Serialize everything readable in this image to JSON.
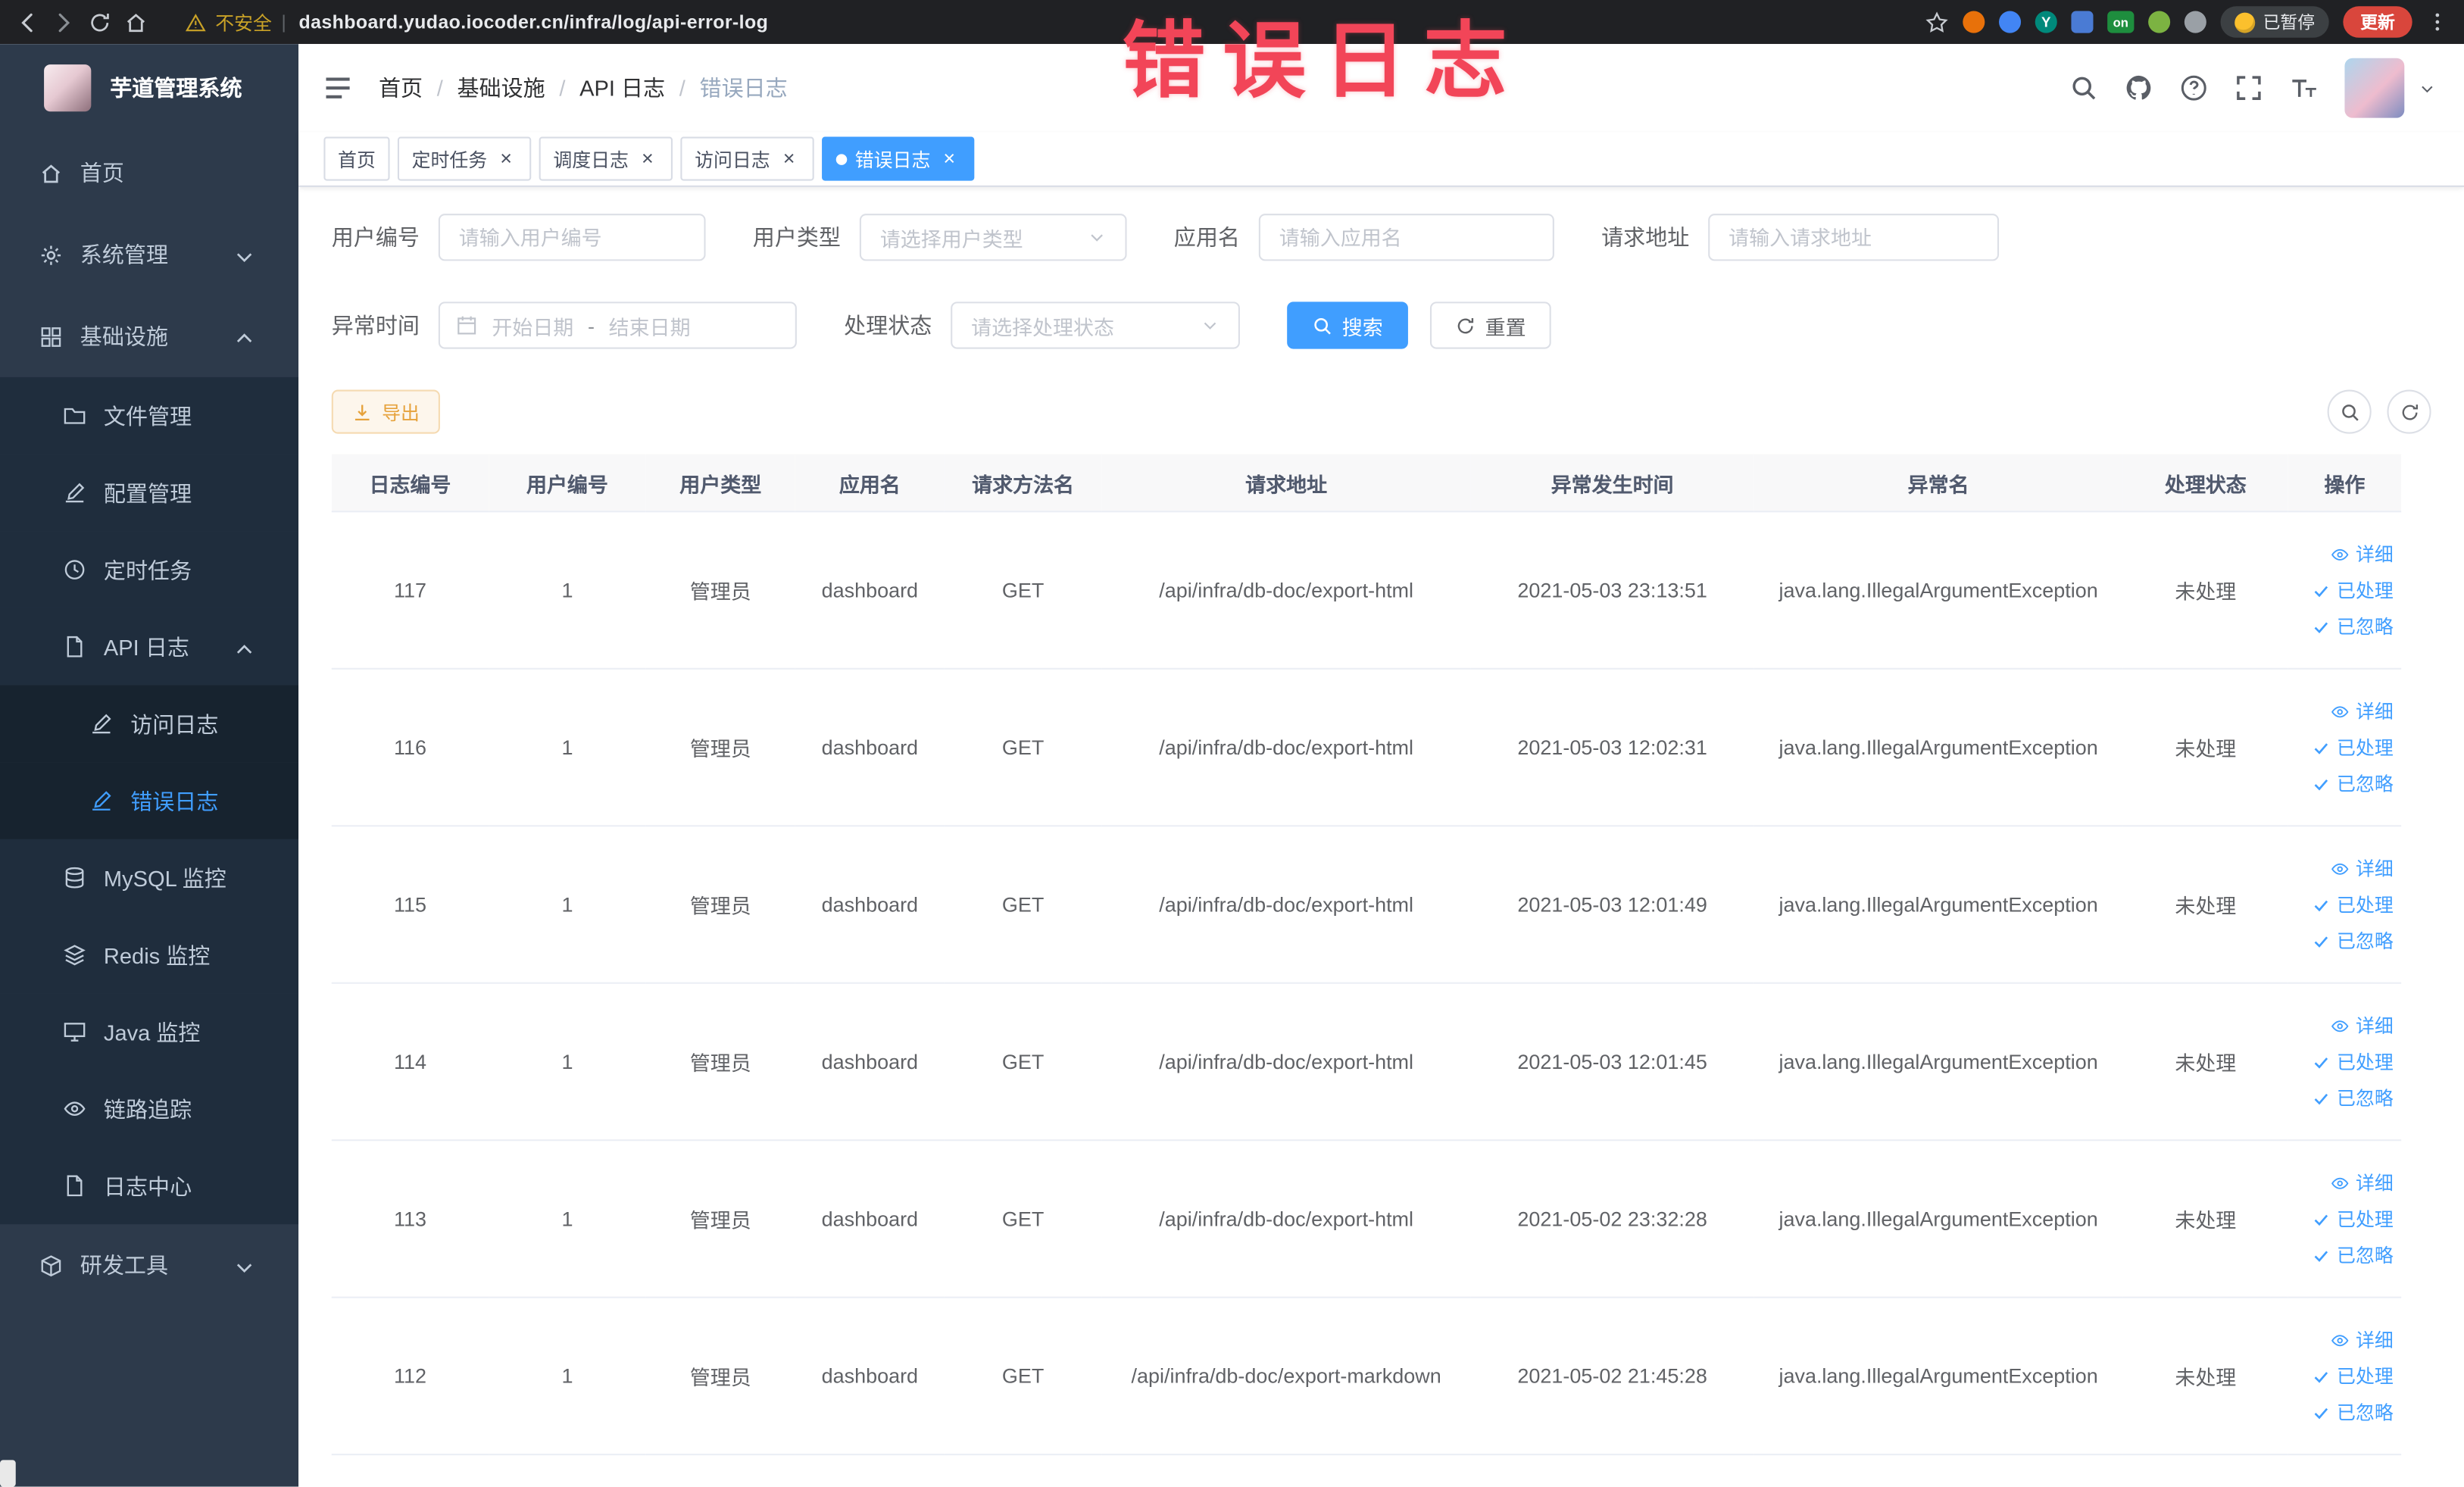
{
  "theme": {
    "accent": "#409eff",
    "sidebar_bg": "#2d3a4b",
    "submenu_bg": "#1f2d3d",
    "nested_submenu_bg": "#17232f",
    "warning": "#e6a23c",
    "watermark_color": "#f24558"
  },
  "browser": {
    "security_label": "不安全",
    "url": "dashboard.yudao.iocoder.cn/infra/log/api-error-log",
    "paused_badge": "已暂停",
    "update_button": "更新",
    "extensions": {
      "on_badge": "on",
      "y_logo": "Y"
    }
  },
  "watermark": {
    "text": "错误日志"
  },
  "sidebar": {
    "logo_title": "芋道管理系统",
    "menu": [
      {
        "name": "home",
        "label": "首页",
        "icon": "home",
        "depth": 1
      },
      {
        "name": "system-management",
        "label": "系统管理",
        "icon": "gear",
        "depth": 1,
        "arrow": "down"
      },
      {
        "name": "infrastructure",
        "label": "基础设施",
        "icon": "grid",
        "depth": 1,
        "arrow": "up"
      },
      {
        "name": "file-management",
        "label": "文件管理",
        "icon": "folder",
        "depth": 2
      },
      {
        "name": "config-management",
        "label": "配置管理",
        "icon": "edit",
        "depth": 2
      },
      {
        "name": "scheduled-tasks",
        "label": "定时任务",
        "icon": "clock",
        "depth": 2
      },
      {
        "name": "api-logs",
        "label": "API 日志",
        "icon": "doc",
        "depth": 2,
        "arrow": "up"
      },
      {
        "name": "access-log",
        "label": "访问日志",
        "icon": "edit",
        "depth": 3
      },
      {
        "name": "error-log",
        "label": "错误日志",
        "icon": "edit",
        "depth": 3,
        "active": true
      },
      {
        "name": "mysql-monitor",
        "label": "MySQL 监控",
        "icon": "db",
        "depth": 2
      },
      {
        "name": "redis-monitor",
        "label": "Redis 监控",
        "icon": "stack",
        "depth": 2
      },
      {
        "name": "java-monitor",
        "label": "Java 监控",
        "icon": "monitor",
        "depth": 2
      },
      {
        "name": "trace",
        "label": "链路追踪",
        "icon": "eye",
        "depth": 2
      },
      {
        "name": "log-center",
        "label": "日志中心",
        "icon": "doc",
        "depth": 2
      },
      {
        "name": "dev-tools",
        "label": "研发工具",
        "icon": "tool",
        "depth": 1,
        "arrow": "down"
      }
    ]
  },
  "navbar": {
    "breadcrumb": [
      "首页",
      "基础设施",
      "API 日志",
      "错误日志"
    ]
  },
  "tabs": [
    {
      "name": "home",
      "label": "首页",
      "closable": false,
      "active": false
    },
    {
      "name": "scheduled-tasks",
      "label": "定时任务",
      "closable": true,
      "active": false
    },
    {
      "name": "schedule-log",
      "label": "调度日志",
      "closable": true,
      "active": false
    },
    {
      "name": "access-log",
      "label": "访问日志",
      "closable": true,
      "active": false
    },
    {
      "name": "error-log",
      "label": "错误日志",
      "closable": true,
      "active": true
    }
  ],
  "filters": {
    "user_id": {
      "label": "用户编号",
      "placeholder": "请输入用户编号"
    },
    "user_type": {
      "label": "用户类型",
      "placeholder": "请选择用户类型"
    },
    "app_name": {
      "label": "应用名",
      "placeholder": "请输入应用名"
    },
    "request_url": {
      "label": "请求地址",
      "placeholder": "请输入请求地址"
    },
    "exception_time": {
      "label": "异常时间",
      "start_placeholder": "开始日期",
      "separator": "-",
      "end_placeholder": "结束日期"
    },
    "process_status": {
      "label": "处理状态",
      "placeholder": "请选择处理状态"
    },
    "search_button": "搜索",
    "reset_button": "重置"
  },
  "toolbar": {
    "export_label": "导出"
  },
  "table": {
    "columns": [
      "日志编号",
      "用户编号",
      "用户类型",
      "应用名",
      "请求方法名",
      "请求地址",
      "异常发生时间",
      "异常名",
      "处理状态",
      "操作"
    ],
    "actions": [
      {
        "name": "detail",
        "label": "详细",
        "icon": "eye"
      },
      {
        "name": "processed",
        "label": "已处理",
        "icon": "check"
      },
      {
        "name": "ignored",
        "label": "已忽略",
        "icon": "check"
      }
    ],
    "rows": [
      {
        "id": "117",
        "user_id": "1",
        "user_type": "管理员",
        "app": "dashboard",
        "method": "GET",
        "url": "/api/infra/db-doc/export-html",
        "time": "2021-05-03 23:13:51",
        "exception": "java.lang.IllegalArgumentException",
        "status": "未处理"
      },
      {
        "id": "116",
        "user_id": "1",
        "user_type": "管理员",
        "app": "dashboard",
        "method": "GET",
        "url": "/api/infra/db-doc/export-html",
        "time": "2021-05-03 12:02:31",
        "exception": "java.lang.IllegalArgumentException",
        "status": "未处理"
      },
      {
        "id": "115",
        "user_id": "1",
        "user_type": "管理员",
        "app": "dashboard",
        "method": "GET",
        "url": "/api/infra/db-doc/export-html",
        "time": "2021-05-03 12:01:49",
        "exception": "java.lang.IllegalArgumentException",
        "status": "未处理"
      },
      {
        "id": "114",
        "user_id": "1",
        "user_type": "管理员",
        "app": "dashboard",
        "method": "GET",
        "url": "/api/infra/db-doc/export-html",
        "time": "2021-05-03 12:01:45",
        "exception": "java.lang.IllegalArgumentException",
        "status": "未处理"
      },
      {
        "id": "113",
        "user_id": "1",
        "user_type": "管理员",
        "app": "dashboard",
        "method": "GET",
        "url": "/api/infra/db-doc/export-html",
        "time": "2021-05-02 23:32:28",
        "exception": "java.lang.IllegalArgumentException",
        "status": "未处理"
      },
      {
        "id": "112",
        "user_id": "1",
        "user_type": "管理员",
        "app": "dashboard",
        "method": "GET",
        "url": "/api/infra/db-doc/export-markdown",
        "time": "2021-05-02 21:45:28",
        "exception": "java.lang.IllegalArgumentException",
        "status": "未处理"
      }
    ]
  }
}
